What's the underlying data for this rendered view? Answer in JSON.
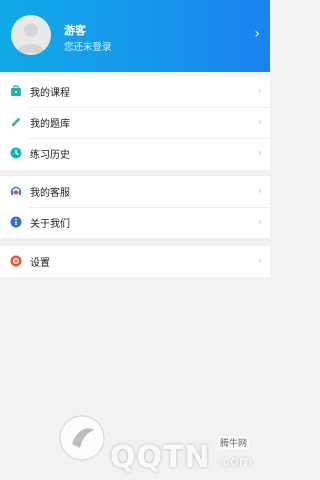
{
  "header": {
    "user_name": "游客",
    "login_hint": "您还未登录",
    "colors": {
      "gradient_start": "#11a9e8",
      "gradient_end": "#1b82f0"
    }
  },
  "menu_groups": [
    [
      {
        "label": "我的课程",
        "icon": "briefcase-icon",
        "color": "#1fb5a4"
      },
      {
        "label": "我的题库",
        "icon": "pencil-icon",
        "color": "#3ec27a"
      },
      {
        "label": "练习历史",
        "icon": "clock-icon",
        "color": "#19b7b0"
      }
    ],
    [
      {
        "label": "我的客服",
        "icon": "headset-icon",
        "color": "#2b86e6"
      },
      {
        "label": "关于我们",
        "icon": "info-icon",
        "color": "#2f6fe0"
      }
    ],
    [
      {
        "label": "设置",
        "icon": "gear-icon",
        "color": "#e8533a"
      }
    ]
  ],
  "watermark": {
    "brand": "QQTN",
    "domain_suffix": ".com",
    "site_name": "腾牛网"
  }
}
